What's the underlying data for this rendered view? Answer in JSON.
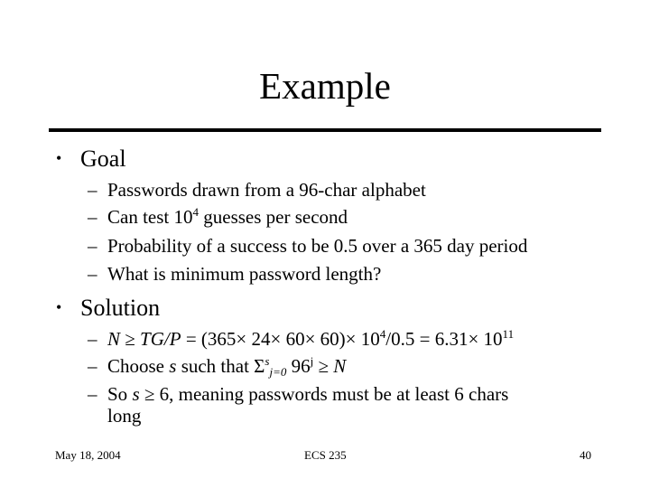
{
  "slide": {
    "title": "Example",
    "sections": [
      {
        "bullet": "•",
        "heading": "Goal",
        "items": [
          {
            "dash": "–",
            "text": "Passwords drawn from a 96-char alphabet"
          },
          {
            "dash": "–",
            "text_pre": "Can test 10",
            "sup": "4",
            "text_post": " guesses per second"
          },
          {
            "dash": "–",
            "text": "Probability of a success to be 0.5 over a 365 day period"
          },
          {
            "dash": "–",
            "text": "What is minimum password length?"
          }
        ]
      },
      {
        "bullet": "•",
        "heading": "Solution",
        "items": [
          {
            "dash": "–",
            "var_n": "N",
            "ge": " ≥ ",
            "var_tgp": "TG/P",
            "mid": " = (365× 24× 60× 60)× 10",
            "sup1": "4",
            "mid2": "/0.5 = 6.31× 10",
            "sup2": "11"
          },
          {
            "dash": "–",
            "pre": "Choose ",
            "var_s": "s",
            "mid": " such that Σ",
            "sup": "s",
            "sub": "j=0",
            "mid2": " 96",
            "sup2": "j",
            "ge": " ≥ ",
            "var_n": "N"
          },
          {
            "dash": "–",
            "pre": "So ",
            "var_s": "s",
            "mid": " ≥ 6, meaning passwords must be at least 6 chars",
            "cont": "long"
          }
        ]
      }
    ]
  },
  "footer": {
    "date": "May 18, 2004",
    "course": "ECS 235",
    "page": "40"
  }
}
